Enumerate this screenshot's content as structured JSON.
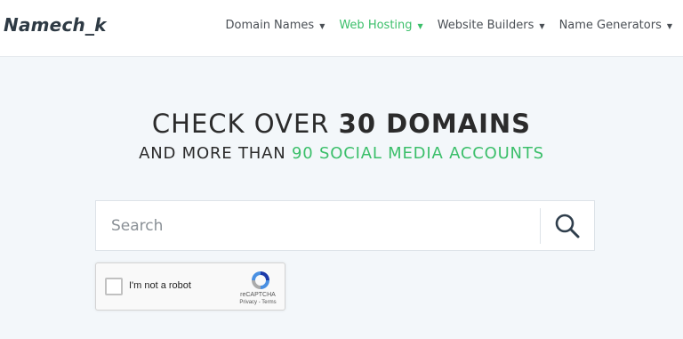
{
  "header": {
    "logo": "Namech_k",
    "nav": [
      {
        "label": "Domain Names",
        "active": false
      },
      {
        "label": "Web Hosting",
        "active": true
      },
      {
        "label": "Website Builders",
        "active": false
      },
      {
        "label": "Name Generators",
        "active": false
      }
    ],
    "caret": "▼"
  },
  "hero": {
    "headline_prefix": "CHECK OVER ",
    "headline_bold": "30 DOMAINS",
    "subline_prefix": "AND MORE THAN ",
    "subline_accent": "90 SOCIAL MEDIA ACCOUNTS"
  },
  "search": {
    "placeholder": "Search",
    "value": "",
    "icon": "search-icon"
  },
  "captcha": {
    "label": "I'm not a robot",
    "brand": "reCAPTCHA",
    "terms": "Privacy - Terms",
    "checked": false
  },
  "colors": {
    "accent": "#3bbf6a",
    "background": "#f3f7fa",
    "text": "#2b2b2b"
  }
}
